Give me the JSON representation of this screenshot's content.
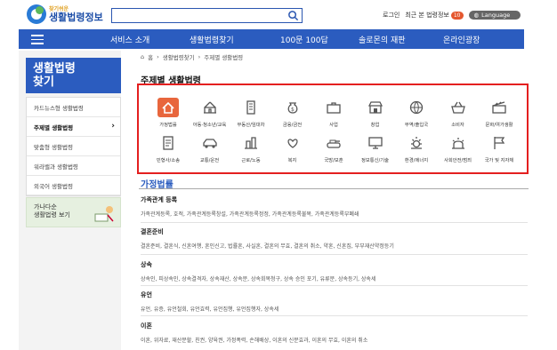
{
  "header": {
    "logo_sub": "찾기쉬운",
    "logo_main": "생활법령정보",
    "search_placeholder": "",
    "login": "로그인",
    "recent": "최근 본 법령정보",
    "recent_count": "10",
    "language": "Language"
  },
  "nav": {
    "items": [
      "서비스 소개",
      "생활법령찾기",
      "100문 100답",
      "솔로몬의 재판",
      "온라인광장"
    ]
  },
  "sidebar": {
    "title_line1": "생활법령",
    "title_line2": "찾기",
    "items": [
      "카드뉴스형 생활법령",
      "주제별 생활법령",
      "맞춤형 생활법령",
      "워라밸과 생활법령",
      "외국어 생활법령"
    ],
    "banner_line1": "가나다순",
    "banner_line2": "생활법령 보기"
  },
  "breadcrumb": {
    "home": "홈",
    "level1": "생활법령찾기",
    "level2": "주제별 생활법령"
  },
  "page_title": "주제별 생활법령",
  "categories": [
    {
      "label": "가정법률",
      "icon": "home-icon"
    },
    {
      "label": "아동·청소년/교육",
      "icon": "school-icon"
    },
    {
      "label": "부동산/임대차",
      "icon": "building-icon"
    },
    {
      "label": "금융/금전",
      "icon": "money-bag-icon"
    },
    {
      "label": "사업",
      "icon": "briefcase-icon"
    },
    {
      "label": "창업",
      "icon": "store-icon"
    },
    {
      "label": "무역/출입국",
      "icon": "globe-icon"
    },
    {
      "label": "소비자",
      "icon": "basket-icon"
    },
    {
      "label": "문화/여가생활",
      "icon": "clapper-icon"
    },
    {
      "label": "민형사/소송",
      "icon": "document-icon"
    },
    {
      "label": "교통/운전",
      "icon": "car-icon"
    },
    {
      "label": "근로/노동",
      "icon": "worker-icon"
    },
    {
      "label": "복지",
      "icon": "care-icon"
    },
    {
      "label": "국방/보훈",
      "icon": "tank-icon"
    },
    {
      "label": "정보통신/기술",
      "icon": "monitor-icon"
    },
    {
      "label": "환경/에너지",
      "icon": "sun-icon"
    },
    {
      "label": "사회안전/범죄",
      "icon": "siren-icon"
    },
    {
      "label": "국가 및 지자체",
      "icon": "flag-icon"
    }
  ],
  "section_title": "가정법률",
  "groups": [
    {
      "heading": "가족관계 등록",
      "topics": "가족관계등록, 호적, 가족관계등록창설, 가족관계등록정정, 가족관계등록불복, 가족관계등록부폐쇄"
    },
    {
      "heading": "결혼준비",
      "topics": "결혼준비, 결혼식, 신혼여행, 혼인신고, 법률혼, 사실혼, 결혼의 무효, 결혼의 취소, 약혼, 신혼집, 부부재산약정등기"
    },
    {
      "heading": "상속",
      "topics": "상속인, 피상속인, 상속결격자, 상속재산, 상속분, 상속회복청구, 상속 승인 포기, 유류분, 상속등기, 상속세"
    },
    {
      "heading": "유언",
      "topics": "유언, 유증, 유언철회, 유언효력, 유언집행, 유언집행자, 상속세"
    },
    {
      "heading": "이혼",
      "topics": "이혼, 위자료, 재산분할, 친권, 양육권, 가정폭력, 손해배상, 이혼의 신분효과, 이혼의 무효, 이혼의 취소"
    }
  ],
  "colors": {
    "primary": "#2b5cbf",
    "highlight_border": "#e41f1f",
    "active_icon_bg": "#e8663d"
  }
}
